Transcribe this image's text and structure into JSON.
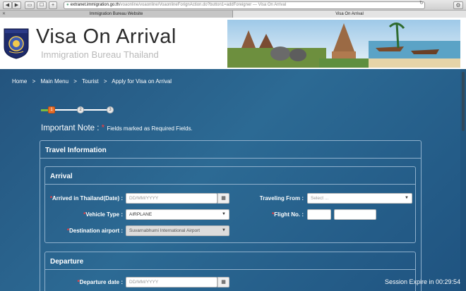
{
  "browser": {
    "url_host": "extranet.immigration.go.th",
    "url_path": "/voaonline/voaonline/VoaonlineForignAction.do?button1=addForeigner",
    "page_title": "— Visa On Arrival",
    "tabs": [
      "Immigration Bureau Website",
      "Visa On Arrival"
    ]
  },
  "header": {
    "title": "Visa On Arrival",
    "subtitle": "Immigration Bureau Thailand"
  },
  "breadcrumb": [
    "Home",
    "Main Menu",
    "Tourist",
    "Apply for Visa on Arrival"
  ],
  "breadcrumb_separator": ">",
  "stepper": {
    "steps": [
      "1",
      "2",
      "3"
    ],
    "current": 1
  },
  "important_note": {
    "label": "Important Note :",
    "star": "*",
    "text": "Fields marked as Required Fields."
  },
  "travel_info": {
    "title": "Travel Information",
    "arrival": {
      "title": "Arrival",
      "arrived_label": "Arrived in Thailand(Date) :",
      "arrived_placeholder": "DD/MM/YYYY",
      "vehicle_label": "Vehicle Type :",
      "vehicle_value": "AIRPLANE",
      "airport_label": "Destination airport :",
      "airport_value": "Suvarnabhumi International Airport",
      "traveling_from_label": "Traveling From :",
      "traveling_from_placeholder": "Select ...",
      "flight_label": "Flight No. :"
    },
    "departure": {
      "title": "Departure",
      "date_label": "Departure date :",
      "date_placeholder": "DD/MM/YYYY"
    }
  },
  "session": {
    "text": "Session Expire in 00:29:54"
  },
  "colors": {
    "main_bg": "#2c6a94",
    "required_star": "#ff3b3b",
    "active_step": "#e76f2a",
    "progress": "#7fbb3a"
  }
}
